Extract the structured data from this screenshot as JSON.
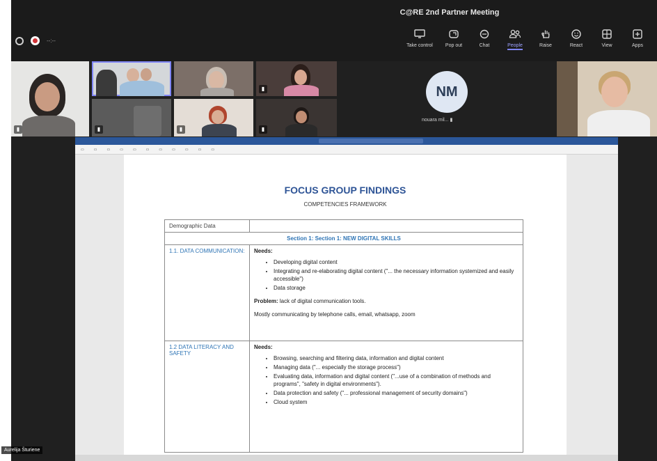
{
  "window": {
    "title": "C@RE 2nd Partner Meeting",
    "timer": "--:--"
  },
  "toolbar": {
    "items": [
      {
        "label": "Take control",
        "icon": "share-screen-icon"
      },
      {
        "label": "Pop out",
        "icon": "pop-out-icon"
      },
      {
        "label": "Chat",
        "icon": "chat-icon"
      },
      {
        "label": "People",
        "icon": "people-icon",
        "active": true
      },
      {
        "label": "Raise",
        "icon": "raise-hand-icon"
      },
      {
        "label": "React",
        "icon": "react-icon"
      },
      {
        "label": "View",
        "icon": "view-icon"
      },
      {
        "label": "Apps",
        "icon": "apps-icon"
      }
    ]
  },
  "participants": {
    "avatar_initials": "NM",
    "avatar_name": "nouara mil..."
  },
  "presenter_name": "Aurelija Šturiene",
  "document": {
    "title": "FOCUS GROUP FINDINGS",
    "subtitle": "COMPETENCIES FRAMEWORK",
    "rows": {
      "demographic_label": "Demographic Data",
      "section_heading": "Section 1:    Section 1: NEW DIGITAL SKILLS",
      "r1_label": "1.1. DATA COMMUNICATION:",
      "r1_needs": "Needs:",
      "r1_items": [
        "Developing digital content",
        "Integrating and re-elaborating digital content (\"... the necessary information systemized and easily accessible\")",
        "Data storage"
      ],
      "r1_problem_label": "Problem:",
      "r1_problem_text": " lack of digital communication tools.",
      "r1_note": "Mostly communicating by telephone calls, email, whatsapp, zoom",
      "r2_label": "1.2 DATA LITERACY AND SAFETY",
      "r2_needs": "Needs:",
      "r2_items": [
        "Browsing, searching and filtering data, information and digital content",
        "Managing data (\"... especially the storage process\")",
        "Evaluating data, information and digital content (\"...use of a combination of methods and programs\", \"safety in digital environments\").",
        "Data protection and safety (\"... professional management of security domains\")",
        "Cloud system"
      ]
    }
  },
  "colors": {
    "accent": "#7f85f5",
    "word_blue": "#2b579a",
    "heading_blue": "#2e5496",
    "recording_red": "#d13438"
  }
}
